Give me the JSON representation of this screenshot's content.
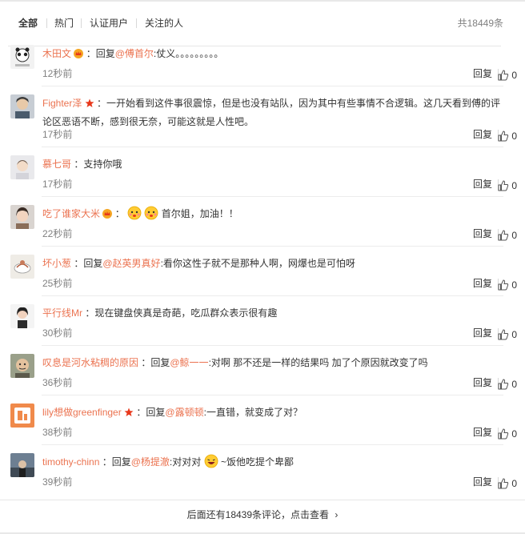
{
  "tabs": [
    {
      "label": "全部",
      "active": true
    },
    {
      "label": "热门",
      "active": false
    },
    {
      "label": "认证用户",
      "active": false
    },
    {
      "label": "关注的人",
      "active": false
    }
  ],
  "total": "共18449条",
  "reply_label": "回复",
  "comments": [
    {
      "user": "木田文",
      "prefix": "：回复",
      "at": "@傅首尔",
      "text": ":仗义。。。。。。。。。",
      "time": "12秒前",
      "likes": "0"
    },
    {
      "user": "Fighter泽",
      "prefix": "：一开始看到这件事很震惊，但是也没有站队，因为其中有些事情不合逻辑。这几天看到傅的评论区恶语不断，感到很无奈，可能这就是人性吧。",
      "at": "",
      "text": "",
      "time": "17秒前",
      "likes": "0"
    },
    {
      "user": "慕七哥",
      "prefix": "：支持你哦",
      "at": "",
      "text": "",
      "time": "17秒前",
      "likes": "0"
    },
    {
      "user": "吃了谁家大米",
      "prefix": "：",
      "at": "",
      "text": "首尔姐，加油！！",
      "time": "22秒前",
      "likes": "0"
    },
    {
      "user": "坏小葱",
      "prefix": "：回复",
      "at": "@赵英男真好",
      "text": ":看你这性子就不是那种人啊，网爆也是可怕呀",
      "time": "25秒前",
      "likes": "0"
    },
    {
      "user": "平行线Mr",
      "prefix": "：现在键盘侠真是奇葩，吃瓜群众表示很有趣",
      "at": "",
      "text": "",
      "time": "30秒前",
      "likes": "0"
    },
    {
      "user": "叹息是河水粘稠的原因",
      "prefix": "：回复",
      "at": "@鲸一一",
      "text": ":对啊 那不还是一样的结果吗 加了个原因就改变了吗",
      "time": "36秒前",
      "likes": "0"
    },
    {
      "user": "lily想做greenfinger",
      "prefix": "：回复",
      "at": "@露顿顿",
      "text": ":一直错，就变成了对？",
      "time": "38秒前",
      "likes": "0"
    },
    {
      "user": "timothy-chinn",
      "prefix": "：回复",
      "at": "@杨提澈",
      "text": ":对对对",
      "text2": "~饭他吃提个卑鄙",
      "time": "39秒前",
      "likes": "0"
    }
  ],
  "footer": "后面还有18439条评论，点击查看",
  "footer_arrow": "›",
  "colors": {
    "accent": "#eb7350",
    "muted": "#808080",
    "badge_star": "#e8381b"
  }
}
